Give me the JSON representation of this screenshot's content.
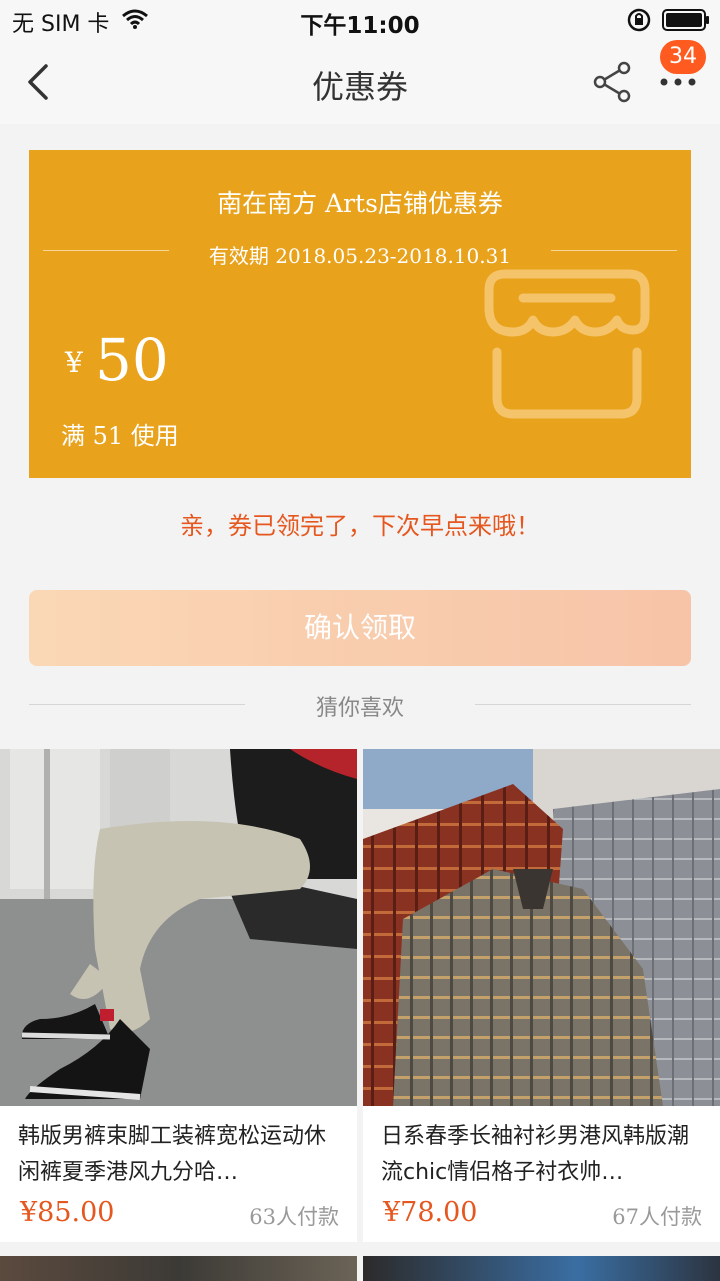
{
  "status_bar": {
    "carrier": "无 SIM 卡",
    "time": "下午11:00"
  },
  "nav": {
    "title": "优惠券",
    "badge_count": "34"
  },
  "coupon": {
    "shop_name": "南在南方 Arts店铺优惠券",
    "validity": "有效期 2018.05.23-2018.10.31",
    "currency": "¥",
    "amount": "50",
    "condition": "满 51 使用",
    "color": "#e8a21b"
  },
  "notice": "亲，券已领完了，下次早点来哦！",
  "confirm_button": "确认领取",
  "recommend_heading": "猜你喜欢",
  "products": [
    {
      "title": "韩版男裤束脚工装裤宽松运动休闲裤夏季港风九分哈…",
      "price": "¥85.00",
      "sold": "63人付款"
    },
    {
      "title": "日系春季长袖衬衫男港风韩版潮流chic情侣格子衬衣帅…",
      "price": "¥78.00",
      "sold": "67人付款"
    }
  ],
  "colors": {
    "accent": "#e5571e",
    "badge": "#ff5a1f",
    "button_start": "#fbd6b2",
    "button_end": "#f8c1a4"
  }
}
